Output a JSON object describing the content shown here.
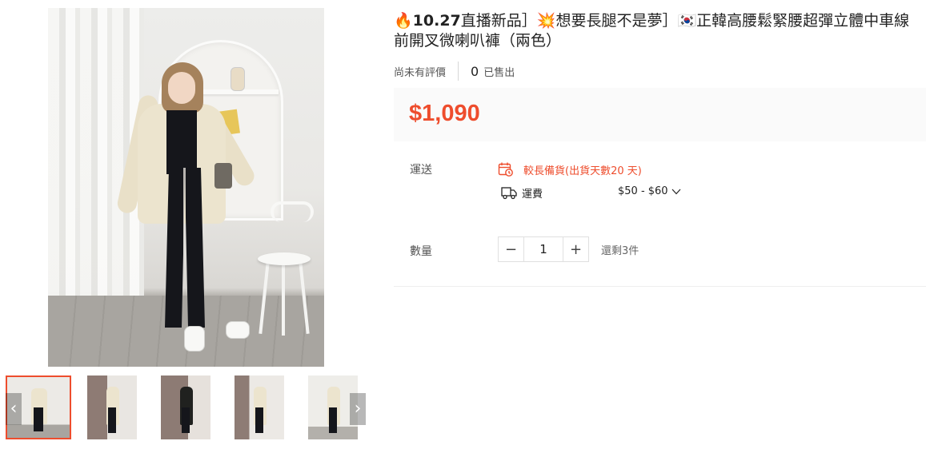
{
  "product": {
    "title_emoji_fire": "🔥",
    "title_date": "10.27",
    "title_part1": "直播新品］",
    "title_emoji_spark": "💥",
    "title_part2": "想要長腿不是夢］",
    "title_emoji_flag": "🇰🇷",
    "title_part3": "正韓高腰鬆緊腰超彈立體中車線前開叉微喇叭褲（兩色）",
    "rating_text": "尚未有評價",
    "sold_count": "0",
    "sold_label": "已售出",
    "price": "$1,090",
    "price_color": "#ee4d2d"
  },
  "shipping": {
    "label": "運送",
    "icon_delay": "calendar-clock-icon",
    "delay_text": "較長備貨(出貨天數20 天)",
    "icon_truck": "truck-icon",
    "fee_label": "運費",
    "fee_range": "$50 - $60",
    "fee_chevron": "chevron-down-icon"
  },
  "quantity": {
    "label": "數量",
    "value": "1",
    "decrease": "−",
    "increase": "+",
    "stock_text": "還剩3件"
  },
  "gallery": {
    "prev_arrow": "‹",
    "next_arrow": "›",
    "thumb_count": 5,
    "selected_index": 0
  }
}
